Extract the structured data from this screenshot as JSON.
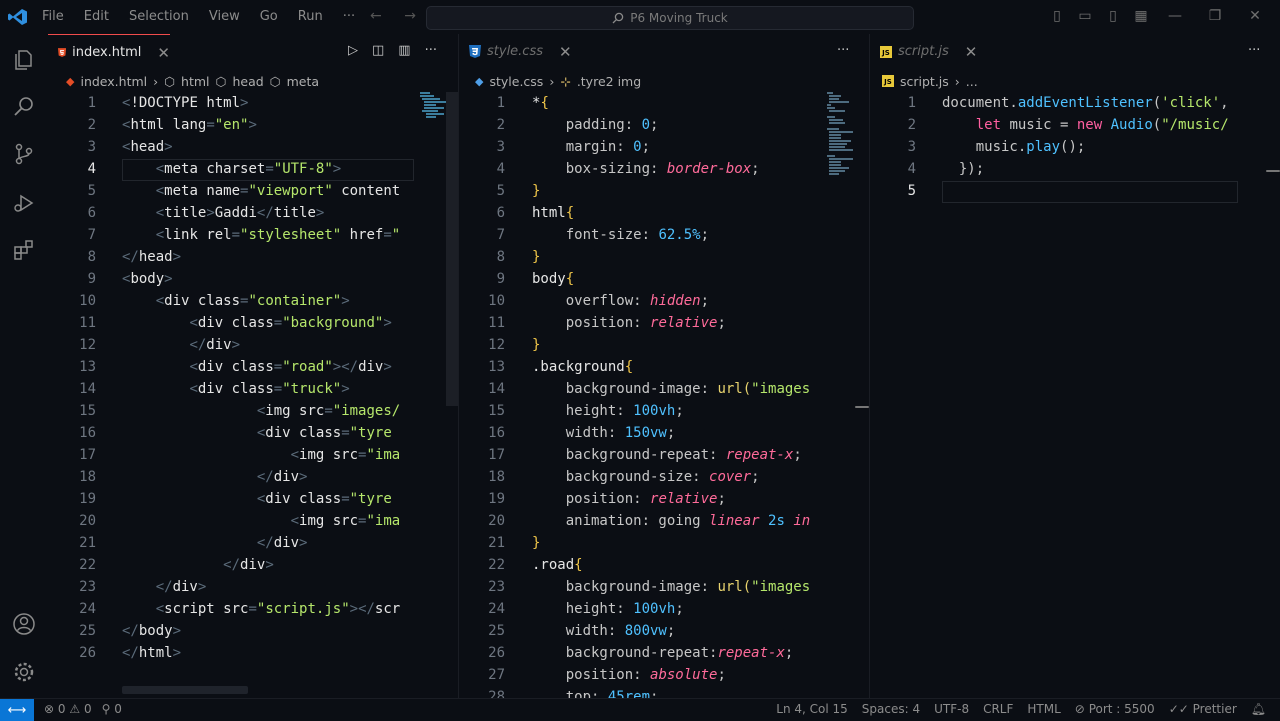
{
  "titlebar": {
    "menu": [
      "File",
      "Edit",
      "Selection",
      "View",
      "Go",
      "Run",
      "···"
    ],
    "nav_back": "←",
    "nav_forward": "→",
    "search": "P6 Moving Truck"
  },
  "activity": [
    "explorer-icon",
    "search-icon",
    "source-control-icon",
    "run-debug-icon",
    "extensions-icon",
    "account-icon",
    "settings-gear-icon"
  ],
  "groups": {
    "html": {
      "tab_label": "index.html",
      "crumbs": [
        "index.html",
        "html",
        "head",
        "meta"
      ]
    },
    "css": {
      "tab_label": "style.css",
      "crumbs": [
        "style.css",
        ".tyre2 img"
      ]
    },
    "js": {
      "tab_label": "script.js",
      "crumbs": [
        "script.js",
        "..."
      ]
    }
  },
  "html_lines": [
    {
      "n": "1",
      "t": "<!DOCTYPE html>"
    },
    {
      "n": "2",
      "t": "<html lang=\"en\">"
    },
    {
      "n": "3",
      "t": "<head>"
    },
    {
      "n": "4",
      "t": "    <meta charset=\"UTF-8\">"
    },
    {
      "n": "5",
      "t": "    <meta name=\"viewport\" content"
    },
    {
      "n": "6",
      "t": "    <title>Gaddi</title>"
    },
    {
      "n": "7",
      "t": "    <link rel=\"stylesheet\" href=\""
    },
    {
      "n": "8",
      "t": "</head>"
    },
    {
      "n": "9",
      "t": "<body>"
    },
    {
      "n": "10",
      "t": "    <div class=\"container\">"
    },
    {
      "n": "11",
      "t": "        <div class=\"background\">"
    },
    {
      "n": "12",
      "t": "        </div>"
    },
    {
      "n": "13",
      "t": "        <div class=\"road\"></div>"
    },
    {
      "n": "14",
      "t": "        <div class=\"truck\">"
    },
    {
      "n": "15",
      "t": "                <img src=\"images/"
    },
    {
      "n": "16",
      "t": "                <div class=\"tyre "
    },
    {
      "n": "17",
      "t": "                    <img src=\"ima"
    },
    {
      "n": "18",
      "t": "                </div>"
    },
    {
      "n": "19",
      "t": "                <div class=\"tyre "
    },
    {
      "n": "20",
      "t": "                    <img src=\"ima"
    },
    {
      "n": "21",
      "t": "                </div>"
    },
    {
      "n": "22",
      "t": "            </div>"
    },
    {
      "n": "23",
      "t": "    </div>"
    },
    {
      "n": "24",
      "t": "    <script src=\"script.js\"></scr"
    },
    {
      "n": "25",
      "t": "</body>"
    },
    {
      "n": "26",
      "t": "</html>"
    }
  ],
  "css_lines": [
    {
      "n": "1",
      "t": "*{"
    },
    {
      "n": "2",
      "t": "    padding: 0;"
    },
    {
      "n": "3",
      "t": "    margin: 0;"
    },
    {
      "n": "4",
      "t": "    box-sizing: border-box;"
    },
    {
      "n": "5",
      "t": "}"
    },
    {
      "n": "6",
      "t": "html{"
    },
    {
      "n": "7",
      "t": "    font-size: 62.5%;"
    },
    {
      "n": "8",
      "t": "}"
    },
    {
      "n": "9",
      "t": "body{"
    },
    {
      "n": "10",
      "t": "    overflow: hidden;"
    },
    {
      "n": "11",
      "t": "    position: relative;"
    },
    {
      "n": "12",
      "t": "}"
    },
    {
      "n": "13",
      "t": ".background{"
    },
    {
      "n": "14",
      "t": "    background-image: url(\"images"
    },
    {
      "n": "15",
      "t": "    height: 100vh;"
    },
    {
      "n": "16",
      "t": "    width: 150vw;"
    },
    {
      "n": "17",
      "t": "    background-repeat: repeat-x;"
    },
    {
      "n": "18",
      "t": "    background-size: cover;"
    },
    {
      "n": "19",
      "t": "    position: relative;"
    },
    {
      "n": "20",
      "t": "    animation: going linear 2s in"
    },
    {
      "n": "21",
      "t": "}"
    },
    {
      "n": "22",
      "t": ".road{"
    },
    {
      "n": "23",
      "t": "    background-image: url(\"images"
    },
    {
      "n": "24",
      "t": "    height: 100vh;"
    },
    {
      "n": "25",
      "t": "    width: 800vw;"
    },
    {
      "n": "26",
      "t": "    background-repeat:repeat-x;"
    },
    {
      "n": "27",
      "t": "    position: absolute;"
    },
    {
      "n": "28",
      "t": "    top: 45rem;"
    }
  ],
  "js_lines": [
    {
      "n": "1",
      "t": "document.addEventListener('click',"
    },
    {
      "n": "2",
      "t": "    let music = new Audio(\"/music/"
    },
    {
      "n": "3",
      "t": "    music.play();"
    },
    {
      "n": "4",
      "t": "  });"
    },
    {
      "n": "5",
      "t": ""
    }
  ],
  "status": {
    "errors": "0",
    "warnings": "0",
    "ports": "0",
    "position": "Ln 4, Col 15",
    "spaces": "Spaces: 4",
    "encoding": "UTF-8",
    "eol": "CRLF",
    "language": "HTML",
    "port": "Port : 5500",
    "formatter": "Prettier"
  }
}
